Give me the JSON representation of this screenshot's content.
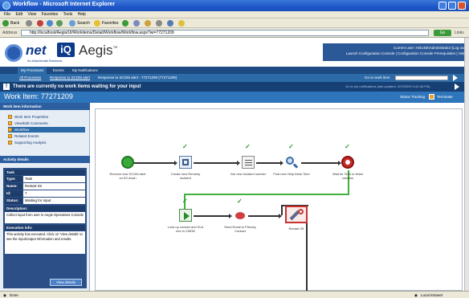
{
  "window": {
    "title": "Workflow - Microsoft Internet Explorer"
  },
  "menubar": {
    "items": [
      "File",
      "Edit",
      "View",
      "Favorites",
      "Tools",
      "Help"
    ]
  },
  "toolbar": {
    "back_label": "Back",
    "search_label": "Search",
    "favorites_label": "Favorites"
  },
  "addressbar": {
    "label": "Address",
    "url": "http://localhost/Aegis/UI/Workitems/Detail/Workflow/Workflow.aspx?wi=77271209",
    "go_label": "Go",
    "links_label": "Links"
  },
  "header": {
    "logo_net": "net",
    "logo_iq": "iQ",
    "logo_sub": "An Attachmate Business",
    "app_name": "Aegis",
    "tm": "™",
    "user_line": "Current user: HOUSE\\Administrator [Log out]",
    "links_line": "Launch Configuration Console | Configuration Console Prerequisites | Help"
  },
  "nav": {
    "tabs": [
      "My Processes",
      "Events",
      "My Notifications"
    ],
    "breadcrumb": [
      "All Processes",
      "Response to SCOM alert",
      "Response to SCOM alert - 77271209 (77271209)"
    ],
    "goto_label": "Go to work item"
  },
  "alert": {
    "icon": "!",
    "message": "There are currently no work items waiting for your input",
    "note": "Go to my notifications (last updated: 3/23/2009 3:42:48 PM)"
  },
  "workitem": {
    "title": "Work Item: 77271209",
    "tracking_label": "Status Tracking",
    "reverse_label": "Terminate"
  },
  "sidebar": {
    "info_header": "Work item information",
    "items": [
      "Work Item Properties",
      "View/Edit Comments",
      "Workflow",
      "Related Events",
      "Supporting Analysis"
    ],
    "active_index": 2,
    "activity_header": "Activity details",
    "task": {
      "header": "Task",
      "rows": [
        {
          "k": "Type:",
          "v": "Task"
        },
        {
          "k": "Name:",
          "v": "Restart IIS"
        },
        {
          "k": "Id:",
          "v": "7"
        },
        {
          "k": "Status:",
          "v": "Waiting for input"
        }
      ],
      "description_label": "Description:",
      "description": "Collect input from user in Aegis Operations Console",
      "execution_label": "Execution info:",
      "execution": "This activity has executed. Click on 'View details' to see the input/output information and results.",
      "view_details": "View details"
    }
  },
  "workflow": {
    "nodes": [
      {
        "label": "Receive new SCOM alert on IIS down",
        "icon": "start-icon"
      },
      {
        "label": "Create new Remedy incident",
        "icon": "form-icon"
      },
      {
        "label": "Get new incident number",
        "icon": "document-icon"
      },
      {
        "label": "Find new Help Desk Tech",
        "icon": "search-icon"
      },
      {
        "label": "Wait for Tech to finish creation",
        "icon": "stop-icon"
      },
      {
        "label": "Look up contact and SLA info in CMDB",
        "icon": "play-icon"
      },
      {
        "label": "Send Email to Primary Contact",
        "icon": "email-icon"
      },
      {
        "label": "Restart IIS",
        "icon": "wrench-icon"
      }
    ]
  },
  "status": {
    "left": "Done",
    "zone": "Local intranet"
  }
}
